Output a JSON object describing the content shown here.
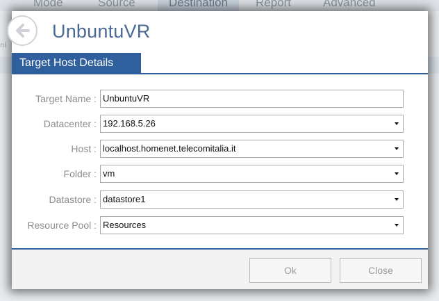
{
  "background": {
    "tabs": [
      {
        "label": "Mode"
      },
      {
        "label": "Source"
      },
      {
        "label": "Destination"
      },
      {
        "label": "Report"
      },
      {
        "label": "Advanced"
      }
    ],
    "side_tab": "ni"
  },
  "dialog": {
    "back_icon": "back-arrow-icon",
    "title": "UnbuntuVR",
    "section_title": "Target Host Details",
    "fields": {
      "target_name": {
        "label": "Target Name :",
        "value": "UnbuntuVR"
      },
      "datacenter": {
        "label": "Datacenter :",
        "value": "192.168.5.26"
      },
      "host": {
        "label": "Host :",
        "value": "localhost.homenet.telecomitalia.it"
      },
      "folder": {
        "label": "Folder :",
        "value": "vm"
      },
      "datastore": {
        "label": "Datastore :",
        "value": "datastore1"
      },
      "resource_pool": {
        "label": "Resource Pool :",
        "value": "Resources"
      }
    },
    "buttons": {
      "ok": "Ok",
      "close": "Close"
    },
    "colors": {
      "accent": "#2f5f9c",
      "title": "#4a6a96",
      "label": "#8c8c8c"
    }
  }
}
